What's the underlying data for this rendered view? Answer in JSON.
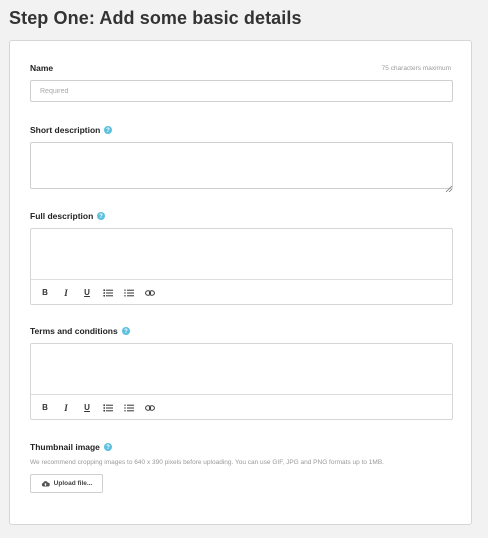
{
  "page_title": "Step One: Add some basic details",
  "form": {
    "name": {
      "label": "Name",
      "char_limit": "75 characters maximum",
      "placeholder": "Required",
      "value": ""
    },
    "short_description": {
      "label": "Short description",
      "value": ""
    },
    "full_description": {
      "label": "Full description",
      "value": "",
      "toolbar": [
        "bold",
        "italic",
        "underline",
        "bulleted-list",
        "numbered-list",
        "link"
      ]
    },
    "terms": {
      "label": "Terms and conditions",
      "value": "",
      "toolbar": [
        "bold",
        "italic",
        "underline",
        "bulleted-list",
        "numbered-list",
        "link"
      ]
    },
    "thumbnail": {
      "label": "Thumbnail image",
      "hint": "We recommend cropping images to 640 x 390 pixels before uploading. You can use GIF, JPG and PNG formats up to 1MB.",
      "upload_label": "Upload file..."
    }
  },
  "toolbar_glyphs": {
    "bold": "B",
    "italic": "I",
    "underline": "U"
  },
  "icons": {
    "help": "question-circle-icon",
    "upload": "cloud-upload-icon"
  },
  "colors": {
    "help_icon": "#5bc0de",
    "page_background": "#f2f2f2",
    "card_background": "#ffffff"
  }
}
